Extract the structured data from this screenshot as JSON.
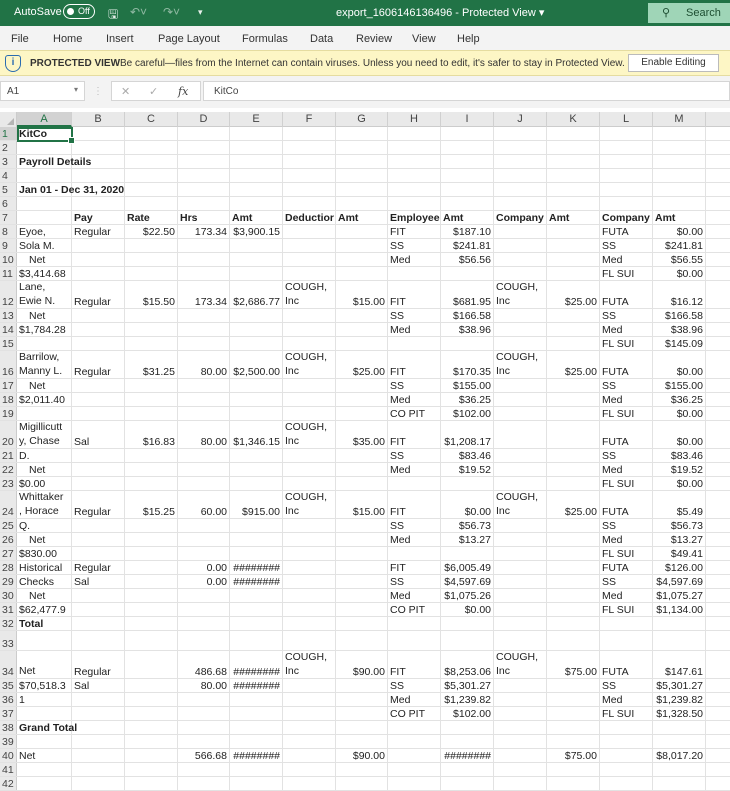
{
  "titlebar": {
    "autosave_label": "AutoSave",
    "autosave_state": "Off",
    "doc_title": "export_1606146136496  -  Protected View  ▾",
    "search_label": "Search"
  },
  "menu": [
    "File",
    "Home",
    "Insert",
    "Page Layout",
    "Formulas",
    "Data",
    "Review",
    "View",
    "Help"
  ],
  "protected_view": {
    "title": "PROTECTED VIEW",
    "message": "Be careful—files from the Internet can contain viruses. Unless you need to edit, it's safer to stay in Protected View.",
    "button": "Enable Editing"
  },
  "formula_bar": {
    "name_box": "A1",
    "fx": "fx",
    "content": "KitCo"
  },
  "columns": [
    "A",
    "B",
    "C",
    "D",
    "E",
    "F",
    "G",
    "H",
    "I",
    "J",
    "K",
    "L",
    "M"
  ],
  "rows": [
    {
      "n": "1",
      "cells": {
        "A": "KitCo"
      }
    },
    {
      "n": "2",
      "cells": {}
    },
    {
      "n": "3",
      "cells": {
        "A": "Payroll Details"
      }
    },
    {
      "n": "4",
      "cells": {}
    },
    {
      "n": "5",
      "cells": {
        "A": "Jan 01 - Dec 31, 2020"
      }
    },
    {
      "n": "6",
      "cells": {}
    },
    {
      "n": "7",
      "cells": {
        "B": "Pay",
        "C": "Rate",
        "D": "Hrs",
        "E": "Amt",
        "F": "Deductior",
        "G": "Amt",
        "H": "Employee",
        "I": "Amt",
        "J": "Company",
        "K": "Amt",
        "L": "Company",
        "M": "Amt"
      }
    },
    {
      "n": "8",
      "cells": {
        "A": "Eyoe,",
        "B": "Regular",
        "C": "$22.50",
        "D": "173.34",
        "E": "$3,900.15",
        "H": "FIT",
        "I": "$187.10",
        "L": "FUTA",
        "M": "$0.00"
      }
    },
    {
      "n": "9",
      "cells": {
        "A": "Sola M.",
        "H": "SS",
        "I": "$241.81",
        "L": "SS",
        "M": "$241.81"
      }
    },
    {
      "n": "10",
      "cells": {
        "A": "Net",
        "H": "Med",
        "I": "$56.56",
        "L": "Med",
        "M": "$56.55"
      }
    },
    {
      "n": "11",
      "cells": {
        "A": "$3,414.68",
        "L": "FL SUI",
        "M": "$0.00"
      }
    },
    {
      "n": "12",
      "cells": {
        "A": "Lane, Ewie N.",
        "B": "Regular",
        "C": "$15.50",
        "D": "173.34",
        "E": "$2,686.77",
        "F": "COUGH, Inc",
        "G": "$15.00",
        "H": "FIT",
        "I": "$681.95",
        "J": "COUGH, Inc",
        "K": "$25.00",
        "L": "FUTA",
        "M": "$16.12"
      }
    },
    {
      "n": "13",
      "cells": {
        "A": "Net",
        "H": "SS",
        "I": "$166.58",
        "L": "SS",
        "M": "$166.58"
      }
    },
    {
      "n": "14",
      "cells": {
        "A": "$1,784.28",
        "H": "Med",
        "I": "$38.96",
        "L": "Med",
        "M": "$38.96"
      }
    },
    {
      "n": "15",
      "cells": {
        "L": "FL SUI",
        "M": "$145.09"
      }
    },
    {
      "n": "16",
      "cells": {
        "A": "Barrilow, Manny L.",
        "B": "Regular",
        "C": "$31.25",
        "D": "80.00",
        "E": "$2,500.00",
        "F": "COUGH, Inc",
        "G": "$25.00",
        "H": "FIT",
        "I": "$170.35",
        "J": "COUGH, Inc",
        "K": "$25.00",
        "L": "FUTA",
        "M": "$0.00"
      }
    },
    {
      "n": "17",
      "cells": {
        "A": "Net",
        "H": "SS",
        "I": "$155.00",
        "L": "SS",
        "M": "$155.00"
      }
    },
    {
      "n": "18",
      "cells": {
        "A": "$2,011.40",
        "H": "Med",
        "I": "$36.25",
        "L": "Med",
        "M": "$36.25"
      }
    },
    {
      "n": "19",
      "cells": {
        "H": "CO PIT",
        "I": "$102.00",
        "L": "FL SUI",
        "M": "$0.00"
      }
    },
    {
      "n": "20",
      "cells": {
        "A": "Migillicutt y, Chase",
        "B": "Sal",
        "C": "$16.83",
        "D": "80.00",
        "E": "$1,346.15",
        "F": "COUGH, Inc",
        "G": "$35.00",
        "H": "FIT",
        "I": "$1,208.17",
        "L": "FUTA",
        "M": "$0.00"
      }
    },
    {
      "n": "21",
      "cells": {
        "A": "D.",
        "H": "SS",
        "I": "$83.46",
        "L": "SS",
        "M": "$83.46"
      }
    },
    {
      "n": "22",
      "cells": {
        "A": "Net",
        "H": "Med",
        "I": "$19.52",
        "L": "Med",
        "M": "$19.52"
      }
    },
    {
      "n": "23",
      "cells": {
        "A": "$0.00",
        "L": "FL SUI",
        "M": "$0.00"
      }
    },
    {
      "n": "24",
      "cells": {
        "A": "Whittaker , Horace",
        "B": "Regular",
        "C": "$15.25",
        "D": "60.00",
        "E": "$915.00",
        "F": "COUGH, Inc",
        "G": "$15.00",
        "H": "FIT",
        "I": "$0.00",
        "J": "COUGH, Inc",
        "K": "$25.00",
        "L": "FUTA",
        "M": "$5.49"
      }
    },
    {
      "n": "25",
      "cells": {
        "A": "Q.",
        "H": "SS",
        "I": "$56.73",
        "L": "SS",
        "M": "$56.73"
      }
    },
    {
      "n": "26",
      "cells": {
        "A": "Net",
        "H": "Med",
        "I": "$13.27",
        "L": "Med",
        "M": "$13.27"
      }
    },
    {
      "n": "27",
      "cells": {
        "A": "$830.00",
        "L": "FL SUI",
        "M": "$49.41"
      }
    },
    {
      "n": "28",
      "cells": {
        "A": "Historical",
        "B": "Regular",
        "D": "0.00",
        "E": "########",
        "H": "FIT",
        "I": "$6,005.49",
        "L": "FUTA",
        "M": "$126.00"
      }
    },
    {
      "n": "29",
      "cells": {
        "A": "Checks",
        "B": "Sal",
        "D": "0.00",
        "E": "########",
        "H": "SS",
        "I": "$4,597.69",
        "L": "SS",
        "M": "$4,597.69"
      }
    },
    {
      "n": "30",
      "cells": {
        "A": "Net",
        "H": "Med",
        "I": "$1,075.26",
        "L": "Med",
        "M": "$1,075.27"
      }
    },
    {
      "n": "31",
      "cells": {
        "A": "$62,477.9",
        "H": "CO PIT",
        "I": "$0.00",
        "L": "FL SUI",
        "M": "$1,134.00"
      }
    },
    {
      "n": "32",
      "cells": {
        "A": "Total"
      }
    },
    {
      "n": "33",
      "cells": {}
    },
    {
      "n": "34",
      "cells": {
        "A": "Net",
        "B": "Regular",
        "D": "486.68",
        "E": "########",
        "F": "COUGH, Inc",
        "G": "$90.00",
        "H": "FIT",
        "I": "$8,253.06",
        "J": "COUGH, Inc",
        "K": "$75.00",
        "L": "FUTA",
        "M": "$147.61"
      }
    },
    {
      "n": "35",
      "cells": {
        "A": "$70,518.3",
        "B": "Sal",
        "D": "80.00",
        "E": "########",
        "H": "SS",
        "I": "$5,301.27",
        "L": "SS",
        "M": "$5,301.27"
      }
    },
    {
      "n": "36",
      "cells": {
        "A": "1",
        "H": "Med",
        "I": "$1,239.82",
        "L": "Med",
        "M": "$1,239.82"
      }
    },
    {
      "n": "37",
      "cells": {
        "H": "CO PIT",
        "I": "$102.00",
        "L": "FL SUI",
        "M": "$1,328.50"
      }
    },
    {
      "n": "38",
      "cells": {
        "A": "Grand Total"
      }
    },
    {
      "n": "39",
      "cells": {}
    },
    {
      "n": "40",
      "cells": {
        "A": "Net",
        "D": "566.68",
        "E": "########",
        "G": "$90.00",
        "I": "########",
        "K": "$75.00",
        "M": "$8,017.20"
      }
    },
    {
      "n": "41",
      "cells": {}
    },
    {
      "n": "42",
      "cells": {}
    }
  ]
}
